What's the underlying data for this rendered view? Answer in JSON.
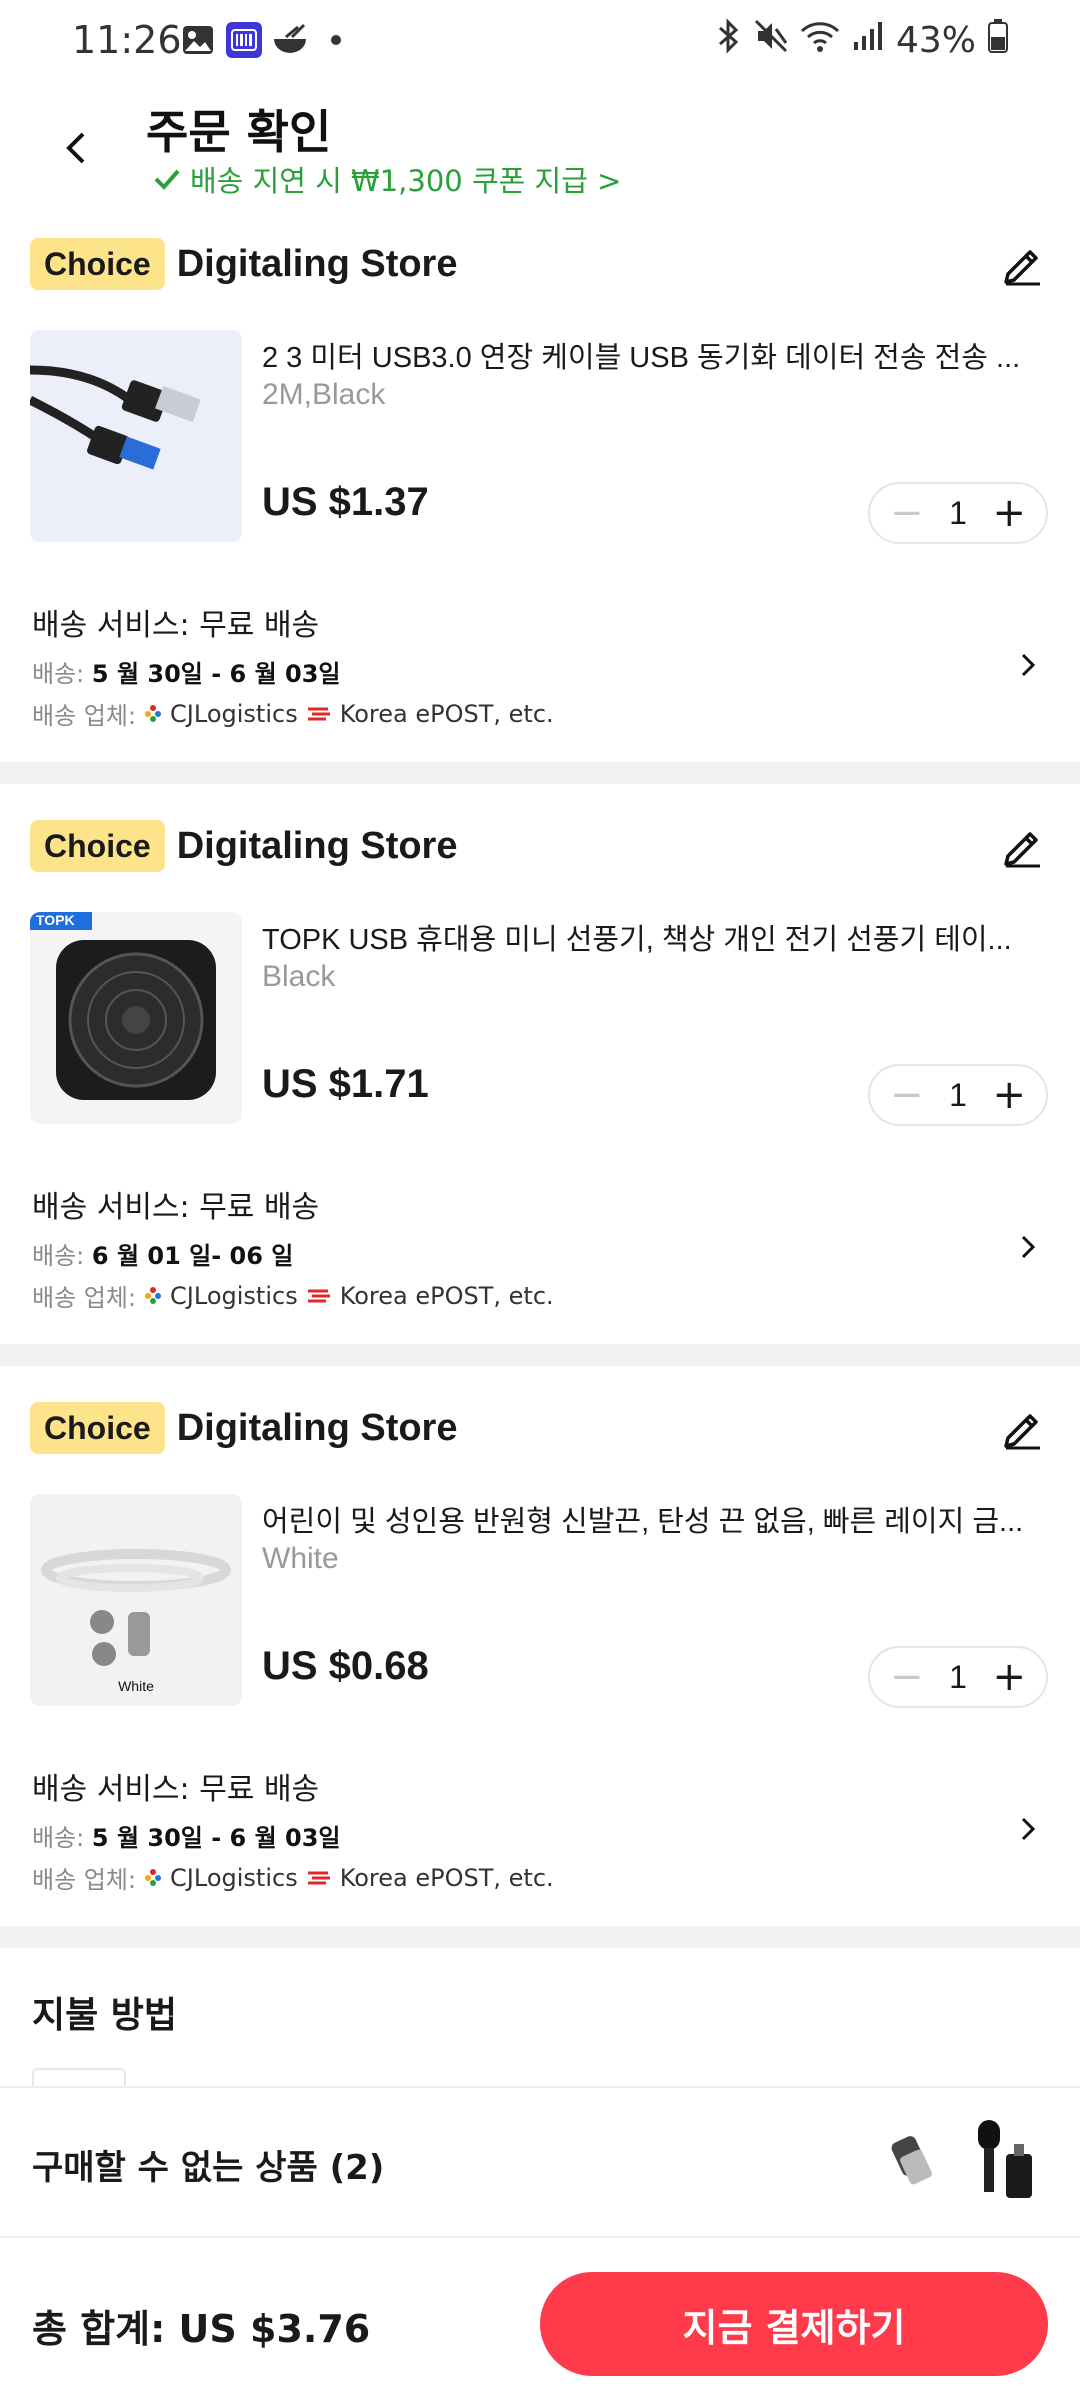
{
  "status_bar": {
    "time": "11:26",
    "battery": "43%"
  },
  "header": {
    "title": "주문 확인",
    "delay_notice": "배송 지연 시 ₩1,300 쿠폰 지급 >"
  },
  "stores": [
    {
      "badge": "Choice",
      "name": "Digitaling Store",
      "product": {
        "title": "2 3 미터 USB3.0 연장 케이블 USB 동기화 데이터 전송 전송 ...",
        "variant": "2M,Black",
        "price": "US $1.37",
        "qty": "1"
      },
      "shipping": {
        "service_label": "배송 서비스:",
        "service_value": "무료 배송",
        "date_label": "배송:",
        "date_value": "5 월 30일 - 6 월 03일",
        "carrier_label": "배송 업체:",
        "carrier_1": "CJLogistics",
        "carrier_2": "Korea ePOST, etc."
      }
    },
    {
      "badge": "Choice",
      "name": "Digitaling Store",
      "product": {
        "title": "TOPK USB 휴대용 미니 선풍기, 책상 개인 전기 선풍기 테이...",
        "variant": "Black",
        "price": "US $1.71",
        "qty": "1",
        "image_tag": "TOPK"
      },
      "shipping": {
        "service_label": "배송 서비스:",
        "service_value": "무료 배송",
        "date_label": "배송:",
        "date_value": "6 월 01 일- 06 일",
        "carrier_label": "배송 업체:",
        "carrier_1": "CJLogistics",
        "carrier_2": "Korea ePOST, etc."
      }
    },
    {
      "badge": "Choice",
      "name": "Digitaling Store",
      "product": {
        "title": "어린이 및 성인용 반원형 신발끈, 탄성 끈 없음, 빠른 레이지 금...",
        "variant": "White",
        "price": "US $0.68",
        "qty": "1",
        "image_caption": "White"
      },
      "shipping": {
        "service_label": "배송 서비스:",
        "service_value": "무료 배송",
        "date_label": "배송:",
        "date_value": "5 월 30일 - 6 월 03일",
        "carrier_label": "배송 업체:",
        "carrier_1": "CJLogistics",
        "carrier_2": "Korea ePOST, etc."
      }
    }
  ],
  "payment": {
    "title": "지불 방법"
  },
  "unavailable": {
    "label": "구매할 수 없는 상품 (2)"
  },
  "footer": {
    "total_label": "총 합계:",
    "total_value": "US $3.76",
    "pay_button": "지금 결제하기"
  },
  "colors": {
    "accent_red": "#ff3a4b",
    "notice_green": "#2aa138",
    "choice_yellow": "#fde38a"
  }
}
